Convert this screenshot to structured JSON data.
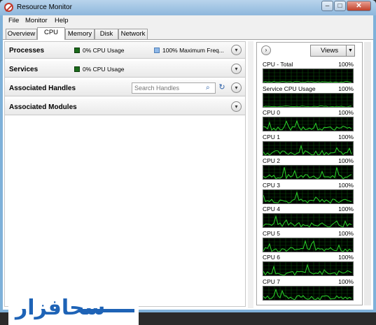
{
  "window": {
    "title": "Resource Monitor"
  },
  "menu": [
    "File",
    "Monitor",
    "Help"
  ],
  "tabs": [
    "Overview",
    "CPU",
    "Memory",
    "Disk",
    "Network"
  ],
  "active_tab": "CPU",
  "sections": {
    "processes": {
      "title": "Processes",
      "cpu_usage": "0% CPU Usage",
      "max_freq": "100% Maximum Freq..."
    },
    "services": {
      "title": "Services",
      "cpu_usage": "0% CPU Usage"
    },
    "handles": {
      "title": "Associated Handles",
      "search_placeholder": "Search Handles"
    },
    "modules": {
      "title": "Associated Modules"
    }
  },
  "right_panel": {
    "views_label": "Views",
    "graphs": [
      {
        "label": "CPU - Total",
        "pct": "100%"
      },
      {
        "label": "Service CPU Usage",
        "pct": "100%"
      },
      {
        "label": "CPU 0",
        "pct": "100%"
      },
      {
        "label": "CPU 1",
        "pct": "100%"
      },
      {
        "label": "CPU 2",
        "pct": "100%"
      },
      {
        "label": "CPU 3",
        "pct": "100%"
      },
      {
        "label": "CPU 4",
        "pct": "100%"
      },
      {
        "label": "CPU 5",
        "pct": "100%"
      },
      {
        "label": "CPU 6",
        "pct": "100%"
      },
      {
        "label": "CPU 7",
        "pct": "100%"
      }
    ]
  },
  "watermark": {
    "text": "سحافزار"
  },
  "colors": {
    "graph_bg": "#000000",
    "graph_line": "#2bd62b",
    "usage_square": "#1b6b1b",
    "freq_square": "#8fb8e8"
  }
}
